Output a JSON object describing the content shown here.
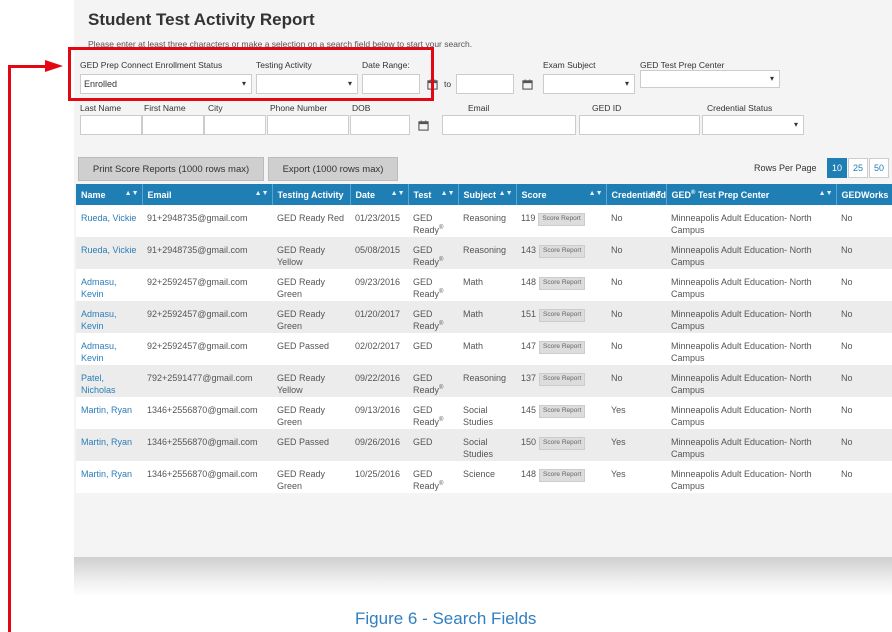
{
  "report": {
    "title": "Student Test Activity Report",
    "hint": "Please enter at least three characters or make a selection on a search field below to start your search."
  },
  "filters": {
    "enrollment_label": "GED Prep Connect Enrollment Status",
    "enrollment_value": "Enrolled",
    "testing_activity_label": "Testing Activity",
    "testing_activity_value": "",
    "date_range_label": "Date Range:",
    "date_from": "",
    "to_label": "to",
    "date_to": "",
    "exam_subject_label": "Exam Subject",
    "exam_subject_value": "",
    "prep_center_label": "GED Test Prep Center",
    "prep_center_value": "",
    "last_name_label": "Last Name",
    "first_name_label": "First Name",
    "city_label": "City",
    "phone_label": "Phone Number",
    "dob_label": "DOB",
    "email_label": "Email",
    "ged_id_label": "GED ID",
    "credential_status_label": "Credential Status",
    "credential_status_value": ""
  },
  "toolbar": {
    "print_label": "Print Score Reports (1000 rows max)",
    "export_label": "Export (1000 rows max)",
    "rows_per_page_label": "Rows Per Page",
    "page_sizes": [
      "10",
      "25",
      "50"
    ],
    "active_page_size": "10"
  },
  "table": {
    "headers": {
      "name": "Name",
      "email": "Email",
      "testing_activity": "Testing Activity",
      "date": "Date",
      "test": "Test",
      "subject": "Subject",
      "score": "Score",
      "credentialed": "Credentialed",
      "center_pre": "GED",
      "center_sup": "®",
      "center_post": " Test Prep Center",
      "gedworks": "GEDWorks"
    },
    "score_report_label": "Score Report",
    "rows": [
      {
        "name": "Rueda, Vickie",
        "email": "91+2948735@gmail.com",
        "activity": "GED Ready Red",
        "date": "01/23/2015",
        "test": "GED Ready",
        "test_sup": "®",
        "subject": "Reasoning",
        "score": "119",
        "credentialed": "No",
        "center": "Minneapolis Adult Education- North Campus",
        "gedworks": "No"
      },
      {
        "name": "Rueda, Vickie",
        "email": "91+2948735@gmail.com",
        "activity": "GED Ready Yellow",
        "date": "05/08/2015",
        "test": "GED Ready",
        "test_sup": "®",
        "subject": "Reasoning",
        "score": "143",
        "credentialed": "No",
        "center": "Minneapolis Adult Education- North Campus",
        "gedworks": "No"
      },
      {
        "name": "Admasu, Kevin",
        "email": "92+2592457@gmail.com",
        "activity": "GED Ready Green",
        "date": "09/23/2016",
        "test": "GED Ready",
        "test_sup": "®",
        "subject": "Math",
        "score": "148",
        "credentialed": "No",
        "center": "Minneapolis Adult Education- North Campus",
        "gedworks": "No"
      },
      {
        "name": "Admasu, Kevin",
        "email": "92+2592457@gmail.com",
        "activity": "GED Ready Green",
        "date": "01/20/2017",
        "test": "GED Ready",
        "test_sup": "®",
        "subject": "Math",
        "score": "151",
        "credentialed": "No",
        "center": "Minneapolis Adult Education- North Campus",
        "gedworks": "No"
      },
      {
        "name": "Admasu, Kevin",
        "email": "92+2592457@gmail.com",
        "activity": "GED Passed",
        "date": "02/02/2017",
        "test": "GED",
        "test_sup": "",
        "subject": "Math",
        "score": "147",
        "credentialed": "No",
        "center": "Minneapolis Adult Education- North Campus",
        "gedworks": "No"
      },
      {
        "name": "Patel, Nicholas",
        "email": "792+2591477@gmail.com",
        "activity": "GED Ready Yellow",
        "date": "09/22/2016",
        "test": "GED Ready",
        "test_sup": "®",
        "subject": "Reasoning",
        "score": "137",
        "credentialed": "No",
        "center": "Minneapolis Adult Education- North Campus",
        "gedworks": "No"
      },
      {
        "name": "Martin, Ryan",
        "email": "1346+2556870@gmail.com",
        "activity": "GED Ready Green",
        "date": "09/13/2016",
        "test": "GED Ready",
        "test_sup": "®",
        "subject": "Social Studies",
        "score": "145",
        "credentialed": "Yes",
        "center": "Minneapolis Adult Education- North Campus",
        "gedworks": "No"
      },
      {
        "name": "Martin, Ryan",
        "email": "1346+2556870@gmail.com",
        "activity": "GED Passed",
        "date": "09/26/2016",
        "test": "GED",
        "test_sup": "",
        "subject": "Social Studies",
        "score": "150",
        "credentialed": "Yes",
        "center": "Minneapolis Adult Education- North Campus",
        "gedworks": "No"
      },
      {
        "name": "Martin, Ryan",
        "email": "1346+2556870@gmail.com",
        "activity": "GED Ready Green",
        "date": "10/25/2016",
        "test": "GED Ready",
        "test_sup": "®",
        "subject": "Science",
        "score": "148",
        "credentialed": "Yes",
        "center": "Minneapolis Adult Education- North Campus",
        "gedworks": "No"
      }
    ]
  },
  "caption": "Figure 6 - Search Fields",
  "colors": {
    "header_blue": "#1f7fb4",
    "link_blue": "#2a7db8",
    "highlight_red": "#e30613",
    "caption_blue": "#2f7fc1"
  },
  "icons": [
    "calendar-icon",
    "sort-icon",
    "select-arrow-icon"
  ]
}
